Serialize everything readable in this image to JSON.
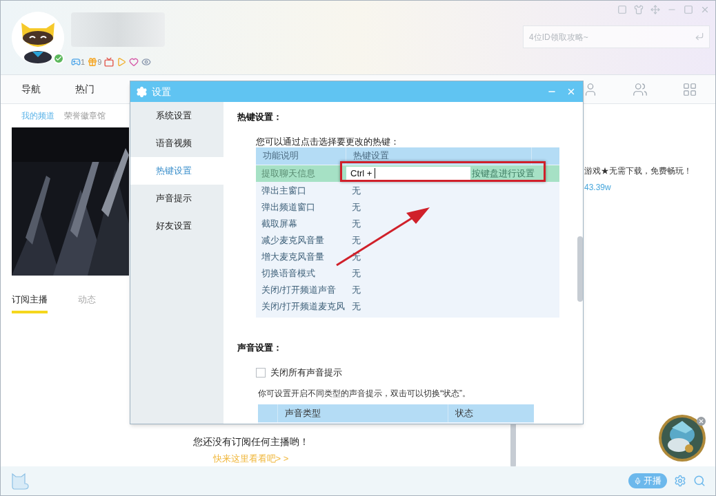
{
  "profile": {
    "verified": true,
    "badges": [
      {
        "kind": "gamepad",
        "count": "1"
      },
      {
        "kind": "gift",
        "count": "9"
      },
      {
        "kind": "tv"
      },
      {
        "kind": "play"
      },
      {
        "kind": "heart"
      },
      {
        "kind": "eye"
      }
    ]
  },
  "search": {
    "placeholder": "4位ID领取攻略~"
  },
  "nav": [
    {
      "label": "导航",
      "selected": false
    },
    {
      "label": "热门",
      "selected": false
    }
  ],
  "subnav": [
    {
      "label": "我的频道",
      "selected": true
    },
    {
      "label": "荣誉徽章馆",
      "selected": false
    }
  ],
  "feed_tabs": [
    {
      "label": "订阅主播",
      "selected": true
    },
    {
      "label": "动态",
      "selected": false
    }
  ],
  "empty_state": {
    "message": "您还没有订阅任何主播哟！",
    "link": "快来这里看看吧> >"
  },
  "promo": {
    "title": "游戏★无需下载，免费畅玩！",
    "count": "43.39w"
  },
  "footer": {
    "live_button": "开播"
  },
  "dialog": {
    "title": "设置",
    "sidebar": [
      {
        "label": "系统设置",
        "selected": false
      },
      {
        "label": "语音视频",
        "selected": false
      },
      {
        "label": "热键设置",
        "selected": true
      },
      {
        "label": "声音提示",
        "selected": false
      },
      {
        "label": "好友设置",
        "selected": false
      }
    ],
    "hotkeys": {
      "heading": "热键设置：",
      "hint": "您可以通过点击选择要更改的热键：",
      "columns": [
        "功能说明",
        "热键设置"
      ],
      "rows": [
        {
          "name": "提取聊天信息",
          "value": "Ctrl + ",
          "action": "按键盘进行设置",
          "selected": true
        },
        {
          "name": "弹出主窗口",
          "value": "无",
          "selected": false
        },
        {
          "name": "弹出频道窗口",
          "value": "无",
          "selected": false
        },
        {
          "name": "截取屏幕",
          "value": "无",
          "selected": false
        },
        {
          "name": "减少麦克风音量",
          "value": "无",
          "selected": false
        },
        {
          "name": "增大麦克风音量",
          "value": "无",
          "selected": false
        },
        {
          "name": "切换语音模式",
          "value": "无",
          "selected": false
        },
        {
          "name": "关闭/打开频道声音",
          "value": "无",
          "selected": false
        },
        {
          "name": "关闭/打开频道麦克风",
          "value": "无",
          "selected": false
        }
      ]
    },
    "sound": {
      "heading": "声音设置：",
      "mute_all": {
        "label": "关闭所有声音提示",
        "checked": false
      },
      "hint": "你可设置开启不同类型的声音提示，双击可以切换“状态”。",
      "columns": [
        "声音类型",
        "状态"
      ]
    }
  }
}
